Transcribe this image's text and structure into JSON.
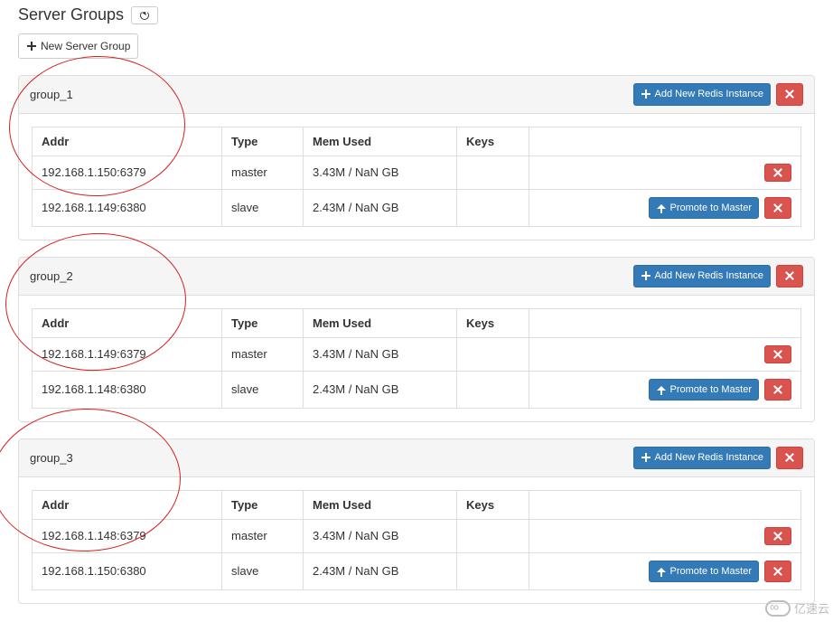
{
  "page_title": "Server Groups",
  "new_group_label": "New Server Group",
  "add_instance_label": "Add New Redis Instance",
  "promote_label": "Promote to Master",
  "columns": {
    "addr": "Addr",
    "type": "Type",
    "mem": "Mem Used",
    "keys": "Keys"
  },
  "groups": [
    {
      "name": "group_1",
      "rows": [
        {
          "addr": "192.168.1.150:6379",
          "type": "master",
          "mem": "3.43M / NaN GB",
          "keys": ""
        },
        {
          "addr": "192.168.1.149:6380",
          "type": "slave",
          "mem": "2.43M / NaN GB",
          "keys": ""
        }
      ]
    },
    {
      "name": "group_2",
      "rows": [
        {
          "addr": "192.168.1.149:6379",
          "type": "master",
          "mem": "3.43M / NaN GB",
          "keys": ""
        },
        {
          "addr": "192.168.1.148:6380",
          "type": "slave",
          "mem": "2.43M / NaN GB",
          "keys": ""
        }
      ]
    },
    {
      "name": "group_3",
      "rows": [
        {
          "addr": "192.168.1.148:6379",
          "type": "master",
          "mem": "3.43M / NaN GB",
          "keys": ""
        },
        {
          "addr": "192.168.1.150:6380",
          "type": "slave",
          "mem": "2.43M / NaN GB",
          "keys": ""
        }
      ]
    }
  ],
  "watermark": "亿速云"
}
